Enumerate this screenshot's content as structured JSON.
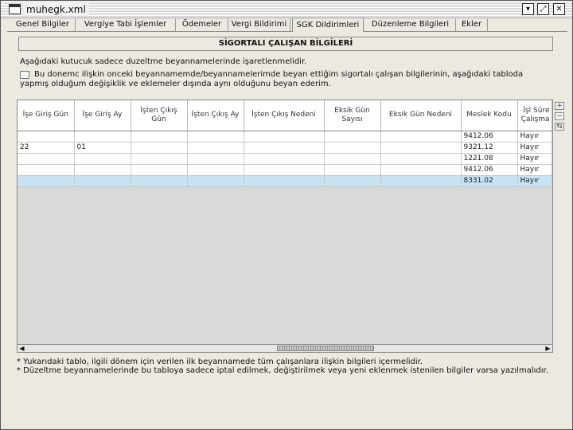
{
  "window": {
    "title": "muhegk.xml"
  },
  "tabs": [
    {
      "label": "Genel Bilgiler"
    },
    {
      "label": "Vergiye Tabi İşlemler"
    },
    {
      "label": "Ödemeler"
    },
    {
      "label": "Vergi Bildirimi"
    },
    {
      "label": "SGK Dildirimleri"
    },
    {
      "label": "Düzenleme Bilgileri"
    },
    {
      "label": "Ekler"
    }
  ],
  "active_tab_index": 4,
  "section": {
    "title": "SİGORTALI ÇALIŞAN BİLGİLERİ",
    "note": "Aşağıdaki kutucuk sadece duzeltme beyannamelerinde işaretlenmelidir.",
    "checkbox_label_line1": "Bu donemc ilişkin onceki beyannamemde/beyannamelerimde beyan ettiğim sigortalı çalışan bilgilerinin, aşağıdaki tabloda",
    "checkbox_label_line2": "yapmış olduğum değişiklik ve eklemeler dışında aynı olduğunu beyan ederim.",
    "checkbox_checked": false
  },
  "table": {
    "columns": [
      "İşe Giriş Gün",
      "İşe Giriş Ay",
      "İşten Çıkış Gün",
      "İşten Çıkış Ay",
      "İşten Çıkış Nedeni",
      "Eksik Gün Sayısı",
      "Eksik Gün Nedeni",
      "Meslek Kodu",
      "İşl Süre Çalışma"
    ],
    "rows": [
      [
        "",
        "",
        "",
        "",
        "",
        "",
        "",
        "9412.06",
        "Hayır"
      ],
      [
        "22",
        "01",
        "",
        "",
        "",
        "",
        "",
        "9321.12",
        "Hayır"
      ],
      [
        "",
        "",
        "",
        "",
        "",
        "",
        "",
        "1221.08",
        "Hayır"
      ],
      [
        "",
        "",
        "",
        "",
        "",
        "",
        "",
        "9412.06",
        "Hayır"
      ],
      [
        "",
        "",
        "",
        "",
        "",
        "",
        "",
        "8331.02",
        "Hayır"
      ]
    ],
    "selected_row_index": 4
  },
  "side_buttons": {
    "add": "+",
    "remove": "−",
    "other": "⇆"
  },
  "footnotes": [
    "* Yukarıdaki tablo, ilgili dönem için verilen ilk beyannamede tüm çalışanlara ilişkin bilgileri içermelidir.",
    "* Düzeltme beyannamelerinde bu tabloya sadece iptal edilmek, değiştirilmek veya yeni eklenmek istenilen bilgiler varsa yazılmalıdır."
  ],
  "colors": {
    "selected_row": "#c8e3f2",
    "panel_bg": "#ece9e1"
  }
}
